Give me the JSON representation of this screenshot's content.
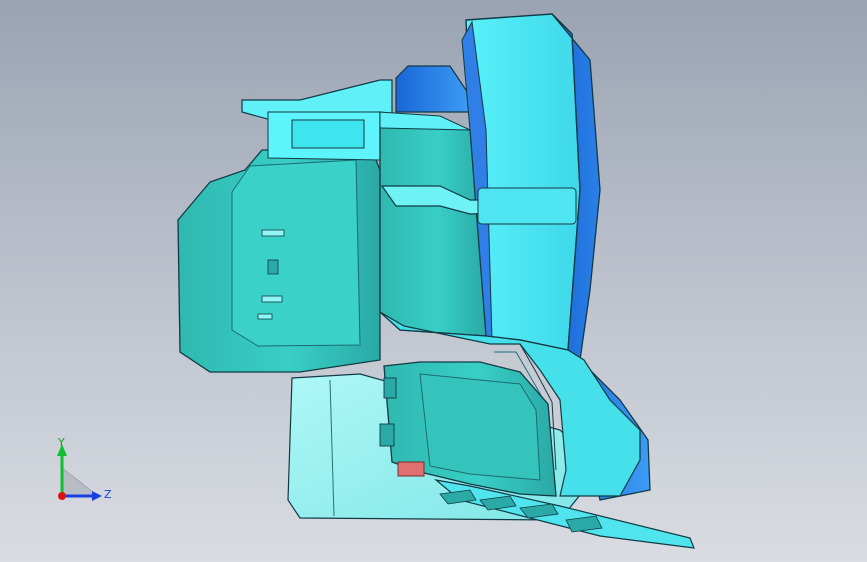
{
  "triad": {
    "y_label": "Y",
    "z_label": "Z",
    "colors": {
      "y": "#10c030",
      "z": "#1a3fe0",
      "origin": "#e01010"
    }
  },
  "colors": {
    "cyan_light": "#5ff6ff",
    "cyan_mid": "#38dcea",
    "teal": "#29b6ad",
    "teal_dark": "#1f9390",
    "blue": "#2f8ef0",
    "blue_dark": "#1060d0",
    "outline": "#123a44",
    "pink": "#e07070"
  }
}
